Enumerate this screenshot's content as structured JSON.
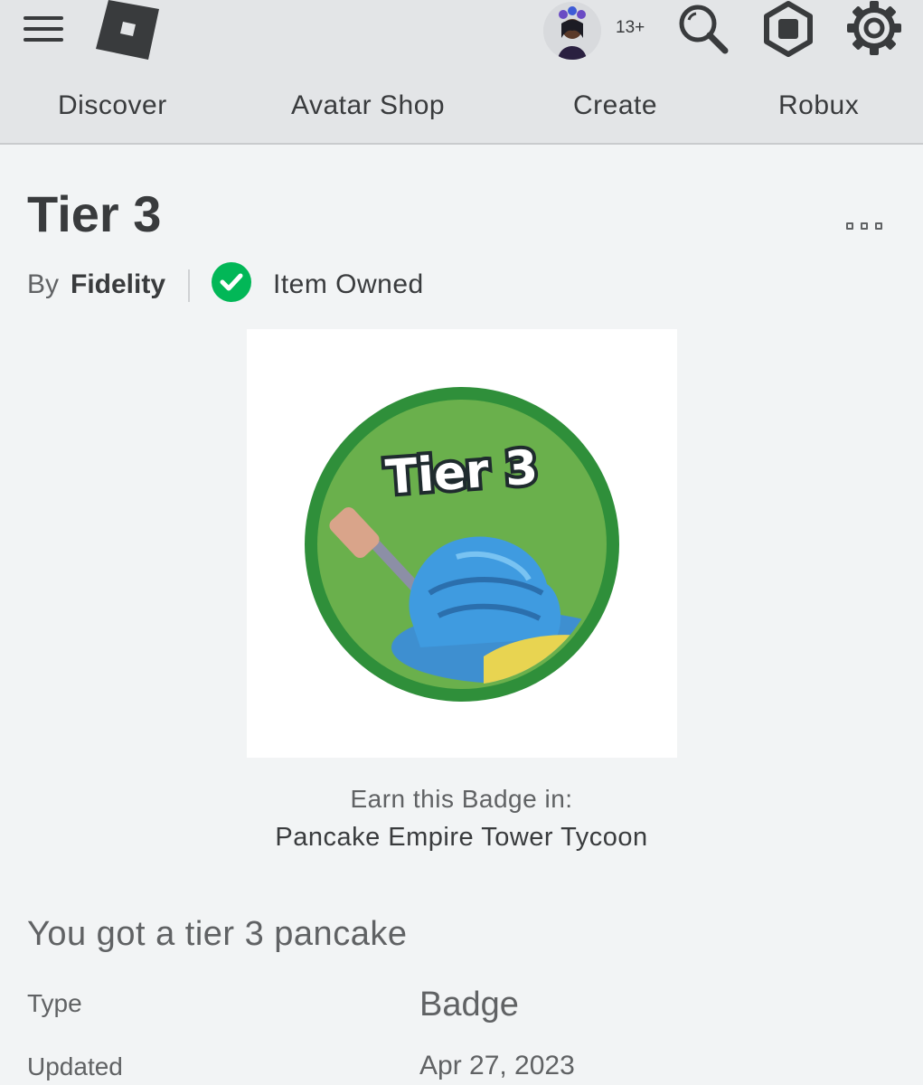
{
  "header": {
    "age_rating": "13+",
    "nav": {
      "discover": "Discover",
      "avatar_shop": "Avatar Shop",
      "create": "Create",
      "robux": "Robux"
    },
    "icons": [
      "menu-icon",
      "roblox-logo",
      "avatar",
      "search-icon",
      "robux-icon",
      "gear-icon"
    ]
  },
  "item": {
    "title": "Tier 3",
    "by_label": "By",
    "creator": "Fidelity",
    "owned_label": "Item Owned",
    "badge_image_text": "Tier 3",
    "earn_label": "Earn this Badge in:",
    "game_name": "Pancake Empire Tower Tycoon",
    "description": "You got a tier 3 pancake"
  },
  "details": {
    "type_label": "Type",
    "type_value": "Badge",
    "updated_label": "Updated",
    "updated_value": "Apr 27, 2023"
  },
  "colors": {
    "topbar": "#e3e5e7",
    "background": "#f2f4f5",
    "owned_check": "#02b757",
    "badge_ring": "#2f8f3a",
    "badge_fill": "#6ab04c"
  }
}
